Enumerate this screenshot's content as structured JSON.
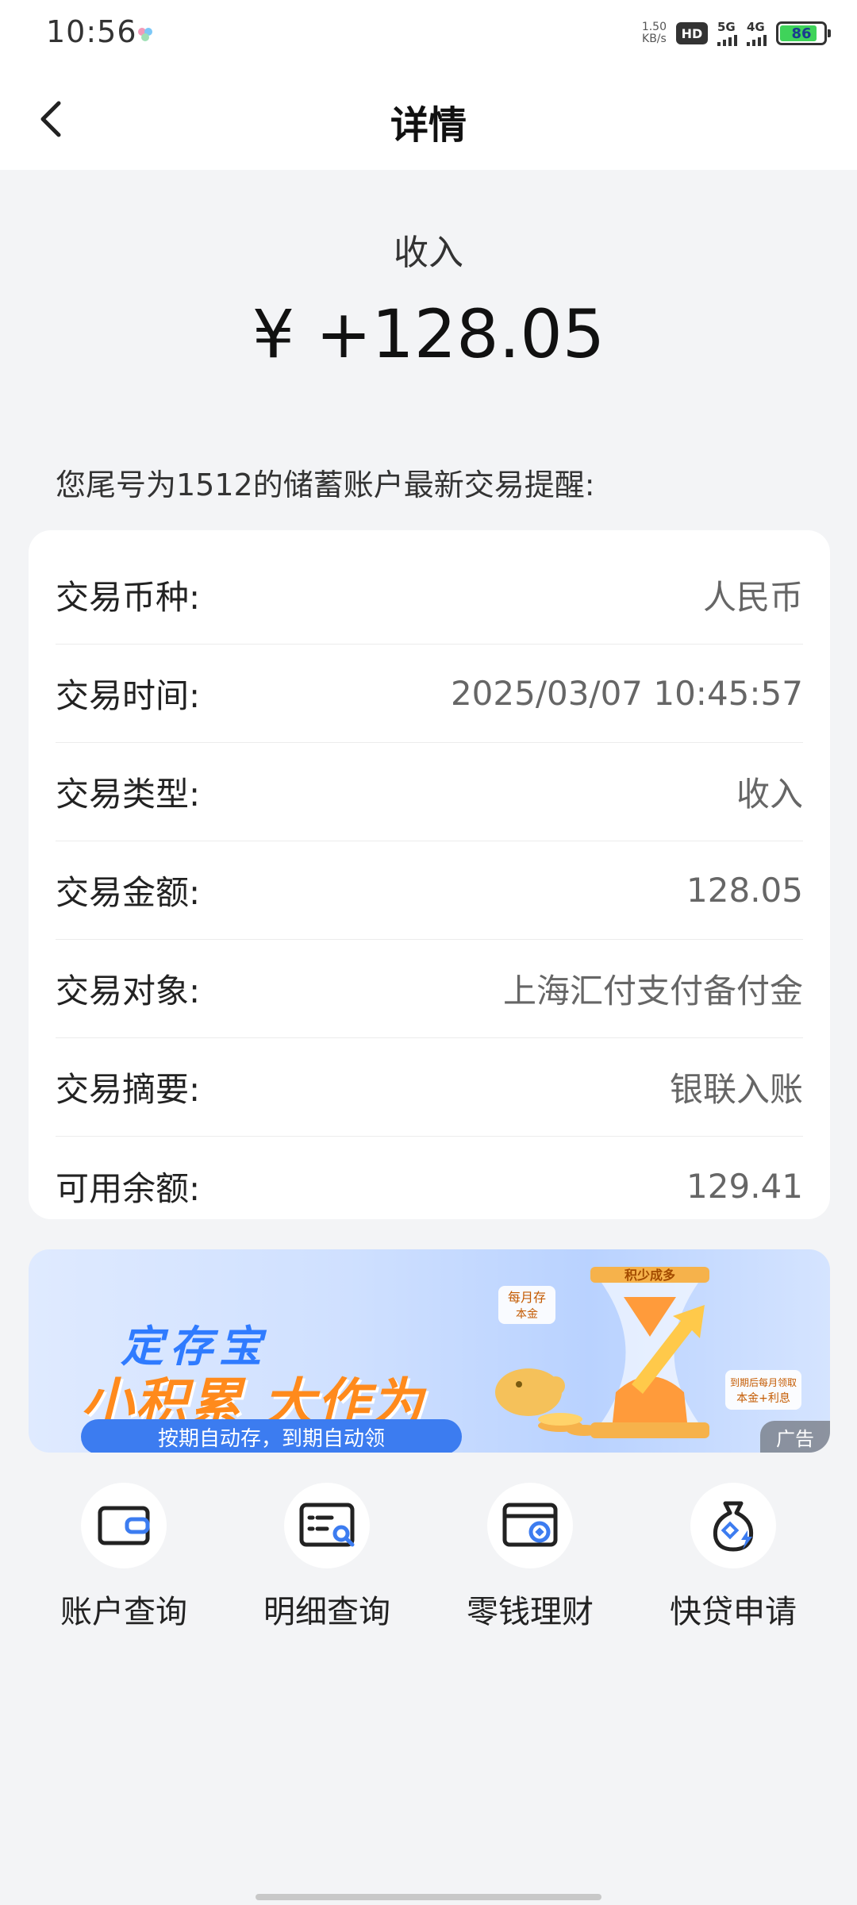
{
  "status_bar": {
    "time": "10:56",
    "net_speed_value": "1.50",
    "net_speed_unit": "KB/s",
    "hd_label": "HD",
    "signal_1": "5G",
    "signal_2": "4G",
    "battery_level": "86",
    "battery_color": "#3fd35a"
  },
  "header": {
    "back_icon": "chevron-left-icon",
    "title": "详情"
  },
  "summary": {
    "type_label": "收入",
    "amount": "¥ +128.05"
  },
  "account_note": "您尾号为1512的储蓄账户最新交易提醒:",
  "details": [
    {
      "label": "交易币种:",
      "value": "人民币"
    },
    {
      "label": "交易时间:",
      "value": "2025/03/07 10:45:57"
    },
    {
      "label": "交易类型:",
      "value": "收入"
    },
    {
      "label": "交易金额:",
      "value": "128.05"
    },
    {
      "label": "交易对象:",
      "value": "上海汇付支付备付金"
    },
    {
      "label": "交易摘要:",
      "value": "银联入账"
    },
    {
      "label": "可用余额:",
      "value": "129.41"
    }
  ],
  "ad": {
    "subtitle": "定存宝",
    "headline": "小积累 大作为",
    "tagline": "按期自动存，到期自动领",
    "art_text_1": "积少成多",
    "art_text_2": "每月存",
    "art_text_3": "本金",
    "art_text_4": "到期后每月领取",
    "art_text_5": "本金+利息",
    "tag": "广告"
  },
  "quick_actions": [
    {
      "label": "账户查询",
      "icon": "wallet-icon"
    },
    {
      "label": "明细查询",
      "icon": "statement-search-icon"
    },
    {
      "label": "零钱理财",
      "icon": "card-coin-icon"
    },
    {
      "label": "快贷申请",
      "icon": "money-bag-bolt-icon"
    }
  ]
}
